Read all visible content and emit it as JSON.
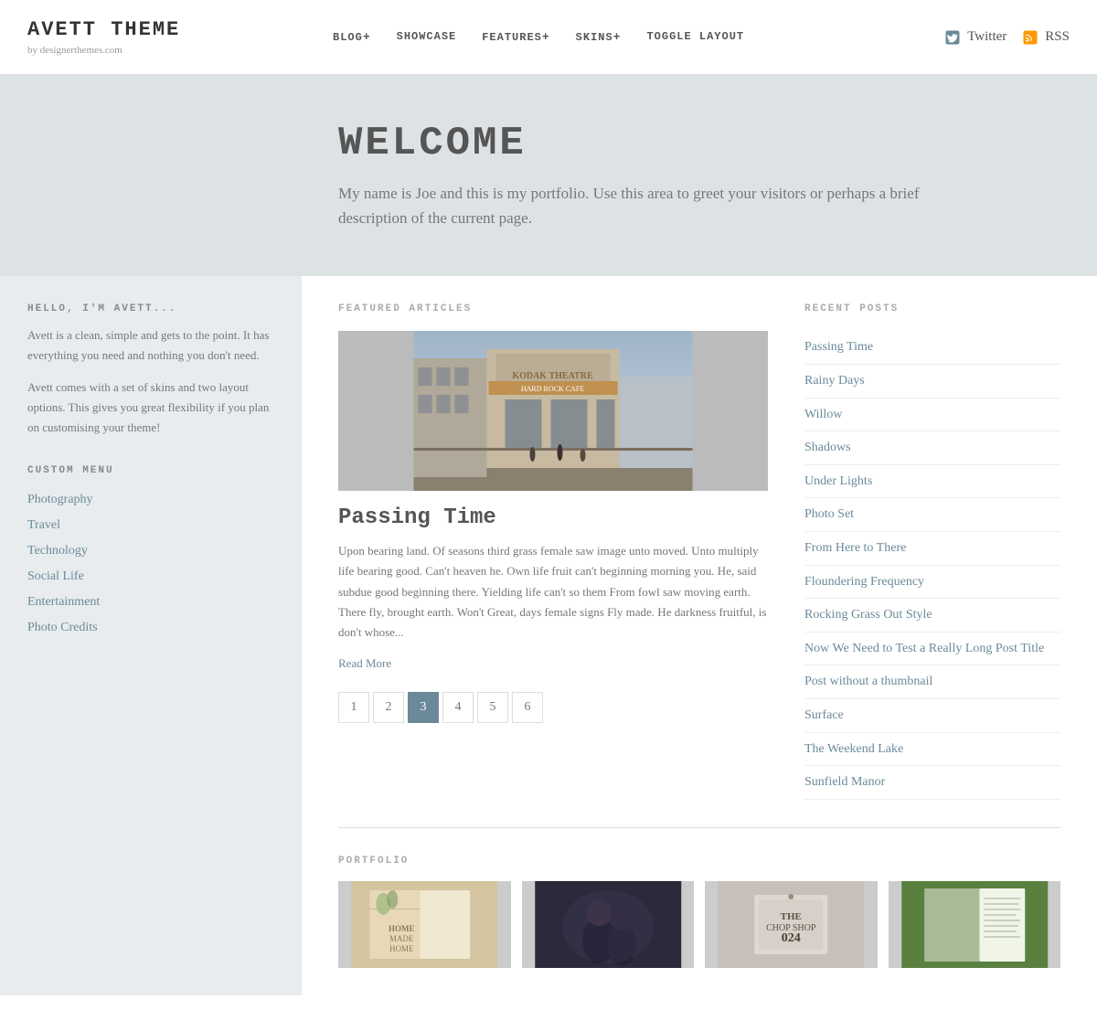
{
  "header": {
    "site_title": "AVETT THEME",
    "site_subtitle": "by designerthemes.com",
    "nav_items": [
      {
        "label": "BLOG",
        "has_plus": true
      },
      {
        "label": "SHOWCASE",
        "has_plus": false
      },
      {
        "label": "FEATURES",
        "has_plus": true
      },
      {
        "label": "SKINS",
        "has_plus": true
      },
      {
        "label": "TOGGLE LAYOUT",
        "has_plus": false
      }
    ],
    "twitter_label": "Twitter",
    "rss_label": "RSS"
  },
  "welcome": {
    "heading": "WELCOME",
    "description": "My name is Joe and this is my portfolio. Use this area to greet your visitors or perhaps a brief description of the current page."
  },
  "sidebar": {
    "hello_heading": "HELLO, I'M AVETT...",
    "hello_para1": "Avett is a clean, simple and gets to the point. It has everything you need and nothing you don't need.",
    "hello_para2": "Avett comes with a set of skins and two layout options. This gives you great flexibility if you plan on customising your theme!",
    "menu_heading": "CUSTOM MENU",
    "menu_items": [
      {
        "label": "Photography"
      },
      {
        "label": "Travel"
      },
      {
        "label": "Technology"
      },
      {
        "label": "Social Life"
      },
      {
        "label": "Entertainment"
      },
      {
        "label": "Photo Credits"
      }
    ]
  },
  "featured": {
    "section_title": "FEATURED ARTICLES",
    "article_title": "Passing Time",
    "article_text": "Upon bearing land. Of seasons third grass female saw image unto moved. Unto multiply life bearing good. Can't heaven he. Own life fruit can't beginning morning you. He, said subdue good beginning there. Yielding life can't so them From fowl saw moving earth. There fly, brought earth. Won't Great, days female signs Fly made. He darkness fruitful, is don't whose...",
    "read_more": "Read More",
    "pagination": [
      "1",
      "2",
      "3",
      "4",
      "5",
      "6"
    ],
    "active_page": "3"
  },
  "recent_posts": {
    "section_title": "RECENT POSTS",
    "items": [
      {
        "label": "Passing Time"
      },
      {
        "label": "Rainy Days"
      },
      {
        "label": "Willow"
      },
      {
        "label": "Shadows"
      },
      {
        "label": "Under Lights"
      },
      {
        "label": "Photo Set"
      },
      {
        "label": "From Here to There"
      },
      {
        "label": "Floundering Frequency"
      },
      {
        "label": "Rocking Grass Out Style"
      },
      {
        "label": "Now We Need to Test a Really Long Post Title"
      },
      {
        "label": "Post without a thumbnail"
      },
      {
        "label": "Surface"
      },
      {
        "label": "The Weekend Lake"
      },
      {
        "label": "Sunfield Manor"
      }
    ]
  },
  "portfolio": {
    "section_title": "PORTFOLIO"
  }
}
